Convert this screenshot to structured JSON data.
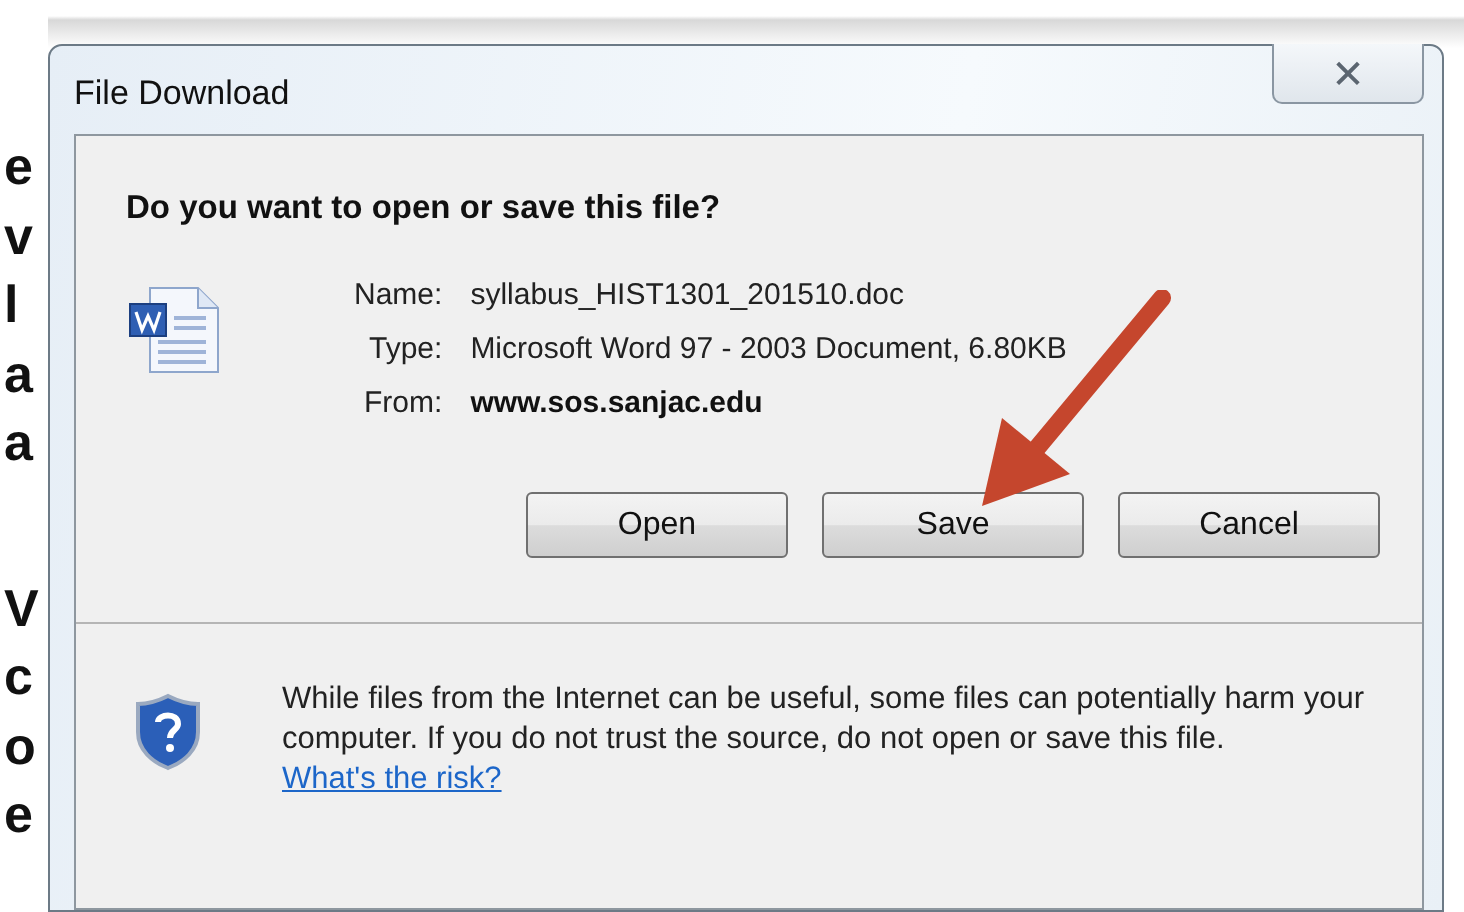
{
  "background_page": {
    "letters": [
      "e",
      "v",
      "l",
      "a",
      "a",
      "V",
      "c",
      "o",
      "e"
    ]
  },
  "window": {
    "title": "File Download",
    "close": "✕"
  },
  "question": "Do you want to open or save this file?",
  "details": [
    {
      "label": "Name:",
      "value": "syllabus_HIST1301_201510.doc",
      "bold": false
    },
    {
      "label": "Type:",
      "value": "Microsoft Word 97 - 2003 Document, 6.80KB",
      "bold": false
    },
    {
      "label": "From:",
      "value": "www.sos.sanjac.edu",
      "bold": true
    }
  ],
  "buttons": [
    "Open",
    "Save",
    "Cancel"
  ],
  "warning": {
    "text": "While files from the Internet can be useful, some files can potentially harm your computer. If you do not trust the source, do not open or save this file.",
    "link": "What's the risk?"
  }
}
